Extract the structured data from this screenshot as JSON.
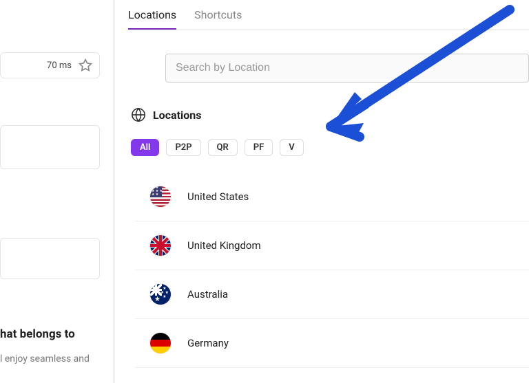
{
  "left": {
    "ping": "70 ms",
    "heading_fragment": "hat belongs to",
    "para_fragment": "l enjoy seamless and"
  },
  "tabs": {
    "locations": "Locations",
    "shortcuts": "Shortcuts"
  },
  "search": {
    "placeholder": "Search by Location"
  },
  "section": {
    "title": "Locations"
  },
  "filters": [
    {
      "label": "All",
      "active": true
    },
    {
      "label": "P2P",
      "active": false
    },
    {
      "label": "QR",
      "active": false
    },
    {
      "label": "PF",
      "active": false
    },
    {
      "label": "V",
      "active": false
    }
  ],
  "locations": [
    {
      "name": "United States",
      "flag": "us"
    },
    {
      "name": "United Kingdom",
      "flag": "uk"
    },
    {
      "name": "Australia",
      "flag": "au"
    },
    {
      "name": "Germany",
      "flag": "de"
    }
  ],
  "annotation": {
    "arrow": true,
    "color": "#1a4fd6"
  }
}
